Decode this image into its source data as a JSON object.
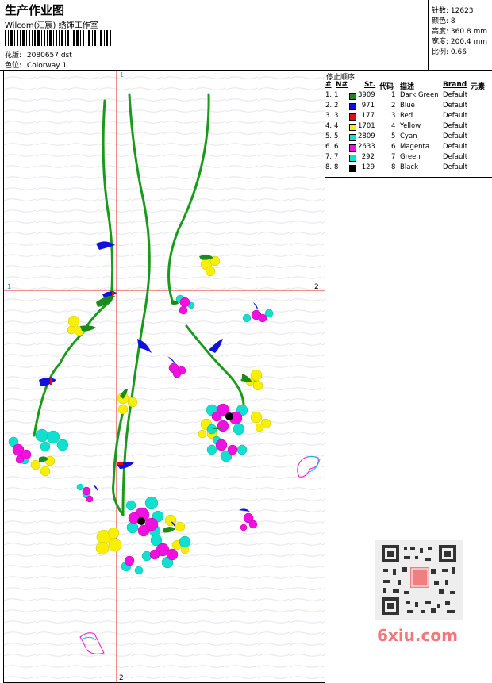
{
  "header": {
    "title": "生产作业图",
    "studio": "Wilcom(汇宸) 绣饰工作室",
    "design_label": "花版:",
    "design_value": "2080657.dst",
    "colorway_label": "色位:",
    "colorway_value": "Colorway 1"
  },
  "stats": {
    "stitches": "针数: 12623",
    "colors": "颜色: 8",
    "height": "高度: 360.8 mm",
    "width": "宽度: 200.4 mm",
    "scale": "比例: 0.66"
  },
  "stop_sequence": {
    "title": "停止顺序:",
    "headers": {
      "num": "#",
      "n": "N#",
      "st": "St.",
      "code": "代码",
      "desc": "描述",
      "brand": "Brand",
      "element": "元素"
    },
    "rows": [
      {
        "num": "1.",
        "n": "1",
        "color": "#1a8a1a",
        "st": "3909",
        "code": "1",
        "desc": "Dark Green",
        "brand": "Default"
      },
      {
        "num": "2.",
        "n": "2",
        "color": "#1010e0",
        "st": "971",
        "code": "2",
        "desc": "Blue",
        "brand": "Default"
      },
      {
        "num": "3.",
        "n": "3",
        "color": "#e01010",
        "st": "177",
        "code": "3",
        "desc": "Red",
        "brand": "Default"
      },
      {
        "num": "4.",
        "n": "4",
        "color": "#f8f000",
        "st": "1701",
        "code": "4",
        "desc": "Yellow",
        "brand": "Default"
      },
      {
        "num": "5.",
        "n": "5",
        "color": "#10e0d0",
        "st": "2809",
        "code": "5",
        "desc": "Cyan",
        "brand": "Default"
      },
      {
        "num": "6.",
        "n": "6",
        "color": "#f010e0",
        "st": "2633",
        "code": "6",
        "desc": "Magenta",
        "brand": "Default"
      },
      {
        "num": "7.",
        "n": "7",
        "color": "#10e0d0",
        "st": "292",
        "code": "7",
        "desc": "Green",
        "brand": "Default"
      },
      {
        "num": "8.",
        "n": "8",
        "color": "#000000",
        "st": "129",
        "code": "8",
        "desc": "Black",
        "brand": "Default"
      }
    ]
  },
  "canvas": {
    "marker_top": "1",
    "marker_left": "1",
    "marker_right": "2",
    "marker_bottom": "2",
    "crosshair_color": "#e02020"
  },
  "watermark": "6xiu.com"
}
